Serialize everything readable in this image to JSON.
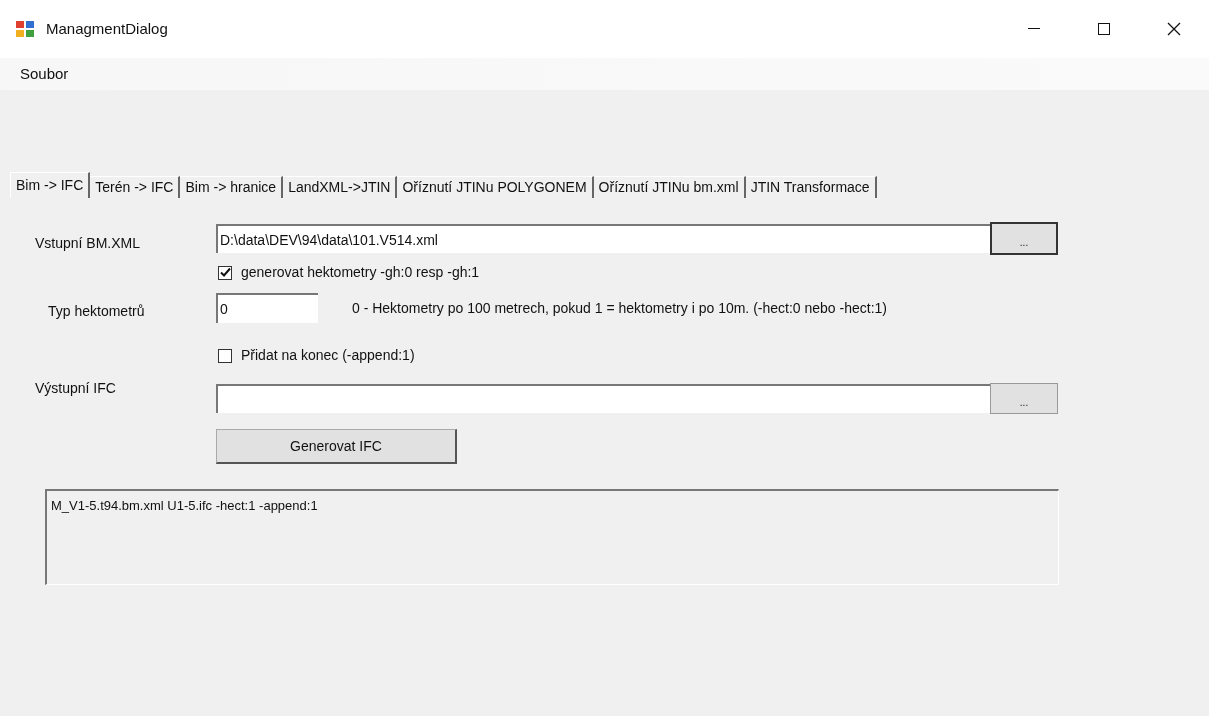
{
  "window": {
    "title": "ManagmentDialog"
  },
  "menu": [
    "Soubor"
  ],
  "tabs": [
    {
      "label": "Bim -> IFC",
      "selected": true
    },
    {
      "label": "Terén -> IFC",
      "selected": false
    },
    {
      "label": "Bim -> hranice",
      "selected": false
    },
    {
      "label": "LandXML->JTIN",
      "selected": false
    },
    {
      "label": "Oříznutí JTINu POLYGONEM",
      "selected": false
    },
    {
      "label": "Oříznutí JTINu bm.xml",
      "selected": false
    },
    {
      "label": "JTIN Transformace",
      "selected": false
    }
  ],
  "input_file": {
    "label": "Vstupní BM.XML",
    "value": "D:\\data\\DEV\\94\\data\\101.V514.xml",
    "browse": "..."
  },
  "generate_hectometers": {
    "label": "generovat hektometry -gh:0 resp -gh:1",
    "checked": true
  },
  "hectometer_type": {
    "label": "Typ hektometrů",
    "value": "0",
    "hint": "0 - Hektometry po 100 metrech, pokud 1 = hektometry i po 10m. (-hect:0  nebo -hect:1)"
  },
  "append": {
    "label": "Přidat na konec (-append:1)",
    "checked": false
  },
  "output_file": {
    "label": "Výstupní IFC",
    "browse": "..."
  },
  "generate_button": "Generovat IFC",
  "command_output": "M_V1-5.t94.bm.xml U1-5.ifc -hect:1 -append:1"
}
